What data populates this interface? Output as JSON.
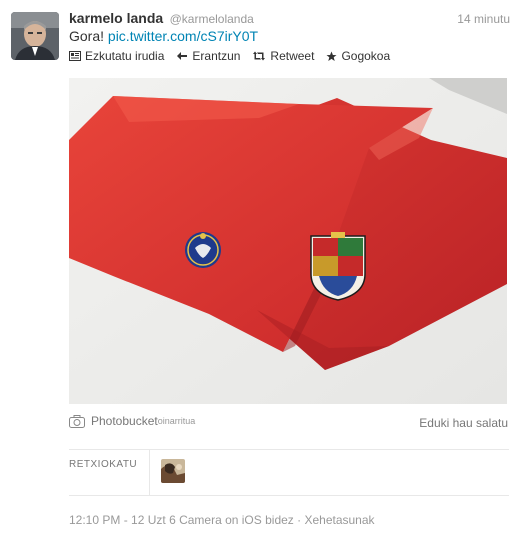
{
  "tweet": {
    "fullname": "karmelo landa",
    "username": "@karmelolanda",
    "timestamp": "14 minutu",
    "text_prefix": "Gora! ",
    "link_text": "pic.twitter.com/cS7irY0T"
  },
  "actions": [
    {
      "label": "Ezkutatu irudia",
      "icon": "image-icon"
    },
    {
      "label": "Erantzun",
      "icon": "reply-icon"
    },
    {
      "label": "Retweet",
      "icon": "retweet-icon"
    },
    {
      "label": "Gogokoa",
      "icon": "star-icon"
    }
  ],
  "media": {
    "provider_name": "Photobucket",
    "provider_sub": "oinarritua",
    "provider_icon": "camera-icon",
    "report_label": "Eduki hau salatu",
    "colors": {
      "scarf": "#e0342f",
      "background": "#eeeeec"
    }
  },
  "retweets": {
    "label": "RETXIOKATU"
  },
  "meta": {
    "time": "12:10 PM - 12 Uzt",
    "separator1": " ",
    "source": "6 Camera on iOS bidez",
    "separator2": " · ",
    "details_link": "Xehetasunak"
  },
  "colors": {
    "link": "#0084b4",
    "text": "#333333",
    "muted": "#999999"
  }
}
